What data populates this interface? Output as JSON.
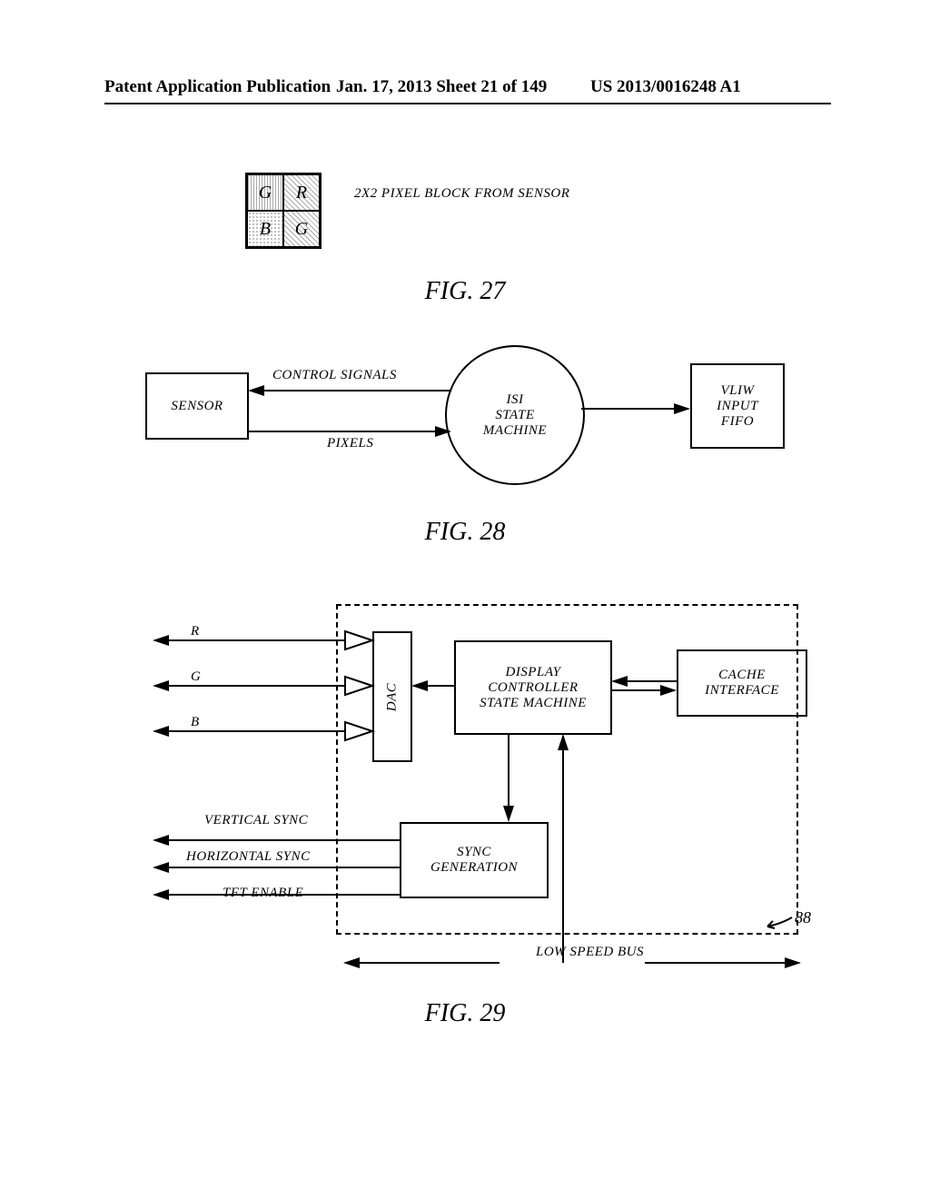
{
  "header": {
    "left": "Patent Application Publication",
    "center": "Jan. 17, 2013  Sheet 21 of 149",
    "right": "US 2013/0016248 A1"
  },
  "fig27": {
    "cells": {
      "tl": "G",
      "tr": "R",
      "bl": "B",
      "br": "G"
    },
    "label": "2X2 PIXEL BLOCK FROM SENSOR",
    "caption": "FIG. 27"
  },
  "fig28": {
    "sensor": "SENSOR",
    "control_signals": "CONTROL SIGNALS",
    "pixels": "PIXELS",
    "isi": "ISI\nSTATE\nMACHINE",
    "vliw": "VLIW\nINPUT\nFIFO",
    "caption": "FIG. 28"
  },
  "fig29": {
    "r": "R",
    "g": "G",
    "b": "B",
    "dac": "DAC",
    "display_controller": "DISPLAY\nCONTROLLER\nSTATE MACHINE",
    "cache": "CACHE\nINTERFACE",
    "sync_gen": "SYNC\nGENERATION",
    "vsync": "VERTICAL SYNC",
    "hsync": "HORIZONTAL SYNC",
    "tft": "TFT ENABLE",
    "low_speed": "LOW SPEED BUS",
    "ref": "88",
    "caption": "FIG. 29"
  }
}
